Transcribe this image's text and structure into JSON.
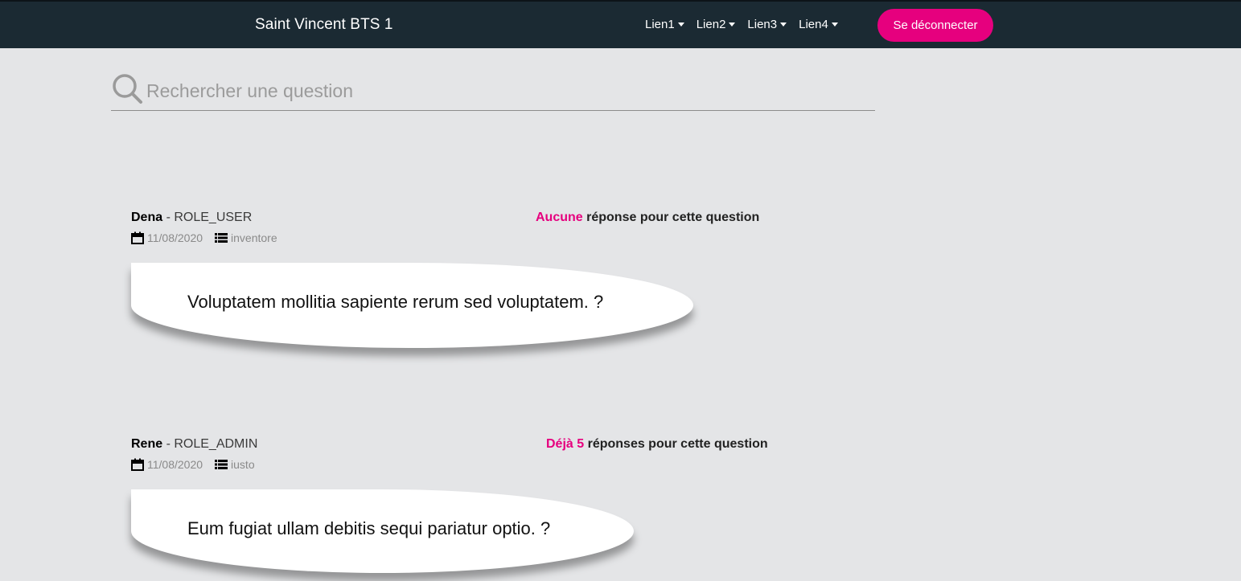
{
  "header": {
    "brand": "Saint Vincent BTS 1",
    "links": [
      "Lien1",
      "Lien2",
      "Lien3",
      "Lien4"
    ],
    "logout_label": "Se déconnecter",
    "accent_color": "#e6007e",
    "bar_color": "#1b2a33"
  },
  "search": {
    "placeholder": "Rechercher une question",
    "icon": "search-icon"
  },
  "questions": [
    {
      "author": "Dena",
      "role": "- ROLE_USER",
      "date": "11/08/2020",
      "category": "inventore",
      "answers_highlight": "Aucune",
      "answers_text": "réponse pour cette question",
      "text": "Voluptatem mollitia sapiente rerum sed voluptatem. ?"
    },
    {
      "author": "Rene",
      "role": "- ROLE_ADMIN",
      "date": "11/08/2020",
      "category": "iusto",
      "answers_highlight": "Déjà 5",
      "answers_text": "réponses pour cette question",
      "text": "Eum fugiat ullam debitis sequi pariatur optio. ?"
    }
  ]
}
